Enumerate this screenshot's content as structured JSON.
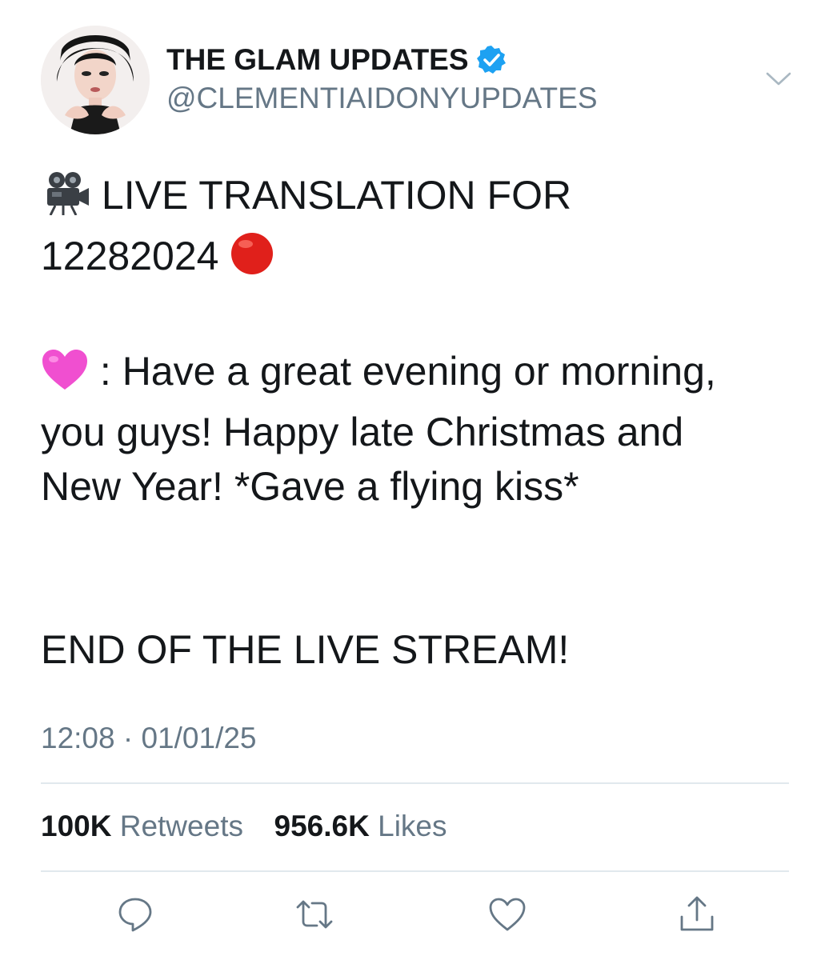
{
  "header": {
    "display_name": "THE GLAM UPDATES",
    "handle": "@CLEMENTIAIDONYUPDATES",
    "verified": true
  },
  "tweet": {
    "line1": "LIVE TRANSLATION FOR",
    "line2": "12282024",
    "line3": ": Have a great evening or morning,",
    "line4": "you guys! Happy late Christmas and",
    "line5": "New Year! *Gave a flying kiss*",
    "line6": "END OF THE LIVE STREAM!",
    "emoji_1": "movie-camera-icon",
    "emoji_2": "red-circle-icon",
    "emoji_3": "pink-heart-icon"
  },
  "meta": {
    "time": "12:08",
    "separator": "·",
    "date": "01/01/25"
  },
  "stats": {
    "retweets_count": "100K",
    "retweets_label": "Retweets",
    "likes_count": "956.6K",
    "likes_label": "Likes"
  },
  "actions": [
    "reply-icon",
    "retweet-icon",
    "like-icon",
    "share-icon"
  ],
  "colors": {
    "text": "#14171a",
    "secondary": "#657786",
    "verified": "#1da1f2",
    "divider": "#e1e8ed",
    "red_circle": "#e0201b",
    "pink_heart": "#f04fd0"
  }
}
